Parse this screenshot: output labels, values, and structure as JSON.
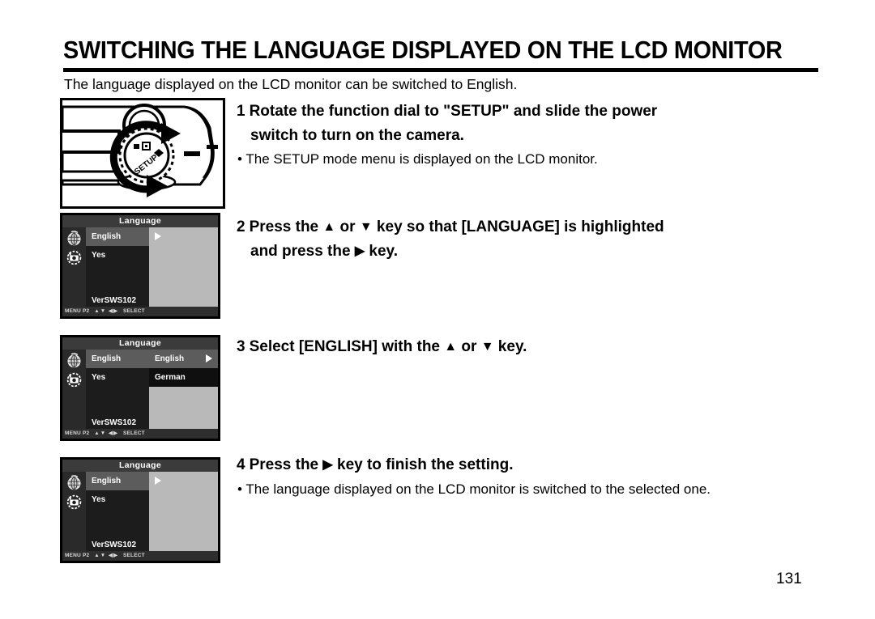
{
  "page": {
    "title": "SWITCHING THE LANGUAGE DISPLAYED ON THE LCD MONITOR",
    "intro": "The language displayed on the LCD monitor can be switched to  English.",
    "page_number": "131"
  },
  "figures": {
    "camera_dial": {
      "dial_label": "SETUP",
      "alt": "camera-mode-dial-illustration"
    }
  },
  "lcd_screens": [
    {
      "title": "Language",
      "icons": [
        "globe-language-icon",
        "camera-reset-icon"
      ],
      "rows": [
        {
          "label": "English",
          "selected": true
        },
        {
          "label": "Yes",
          "selected": false
        }
      ],
      "version": "VerSWS102",
      "value_pane": {
        "type": "arrow",
        "arrow": "▶"
      },
      "status": {
        "menu": "MENU P2",
        "keys": "▲▼ ◀▶",
        "action": "SELECT"
      }
    },
    {
      "title": "Language",
      "icons": [
        "globe-language-icon",
        "camera-reset-icon"
      ],
      "rows": [
        {
          "label": "English",
          "selected": true
        },
        {
          "label": "Yes",
          "selected": false
        }
      ],
      "version": "VerSWS102",
      "value_pane": {
        "type": "submenu",
        "options": [
          {
            "label": "English",
            "selected": true,
            "marker": "▷"
          },
          {
            "label": "German",
            "selected": false,
            "marker": ""
          }
        ]
      },
      "status": {
        "menu": "MENU P2",
        "keys": "▲▼ ◀▶",
        "action": "SELECT"
      }
    },
    {
      "title": "Language",
      "icons": [
        "globe-language-icon",
        "camera-reset-icon"
      ],
      "rows": [
        {
          "label": "English",
          "selected": true
        },
        {
          "label": "Yes",
          "selected": false
        }
      ],
      "version": "VerSWS102",
      "value_pane": {
        "type": "arrow",
        "arrow": "▶"
      },
      "status": {
        "menu": "MENU P2",
        "keys": "▲▼ ◀▶",
        "action": "SELECT"
      }
    }
  ],
  "steps": [
    {
      "num": "1",
      "line1": "Rotate the function dial to \"SETUP\" and slide the power",
      "line2": "switch  to  turn on the camera.",
      "bullet": "•  The SETUP mode menu is displayed on the LCD monitor."
    },
    {
      "num": "2",
      "line1_a": "Press the ",
      "line1_up": "▲",
      "line1_b": " or ",
      "line1_down": "▼",
      "line1_c": " key so that [LANGUAGE] is highlighted",
      "line2_a": "and press the ",
      "line2_right": "▶",
      "line2_b": "  key."
    },
    {
      "num": "3",
      "line1_a": "Select [ENGLISH] with the ",
      "line1_up": "▲",
      "line1_b": " or ",
      "line1_down": "▼",
      "line1_c": "  key."
    },
    {
      "num": "4",
      "line1_a": "Press the ",
      "line1_right": "▶",
      "line1_b": "  key to finish the setting.",
      "bullet": "•  The language displayed on the LCD monitor is switched to the selected one."
    }
  ]
}
